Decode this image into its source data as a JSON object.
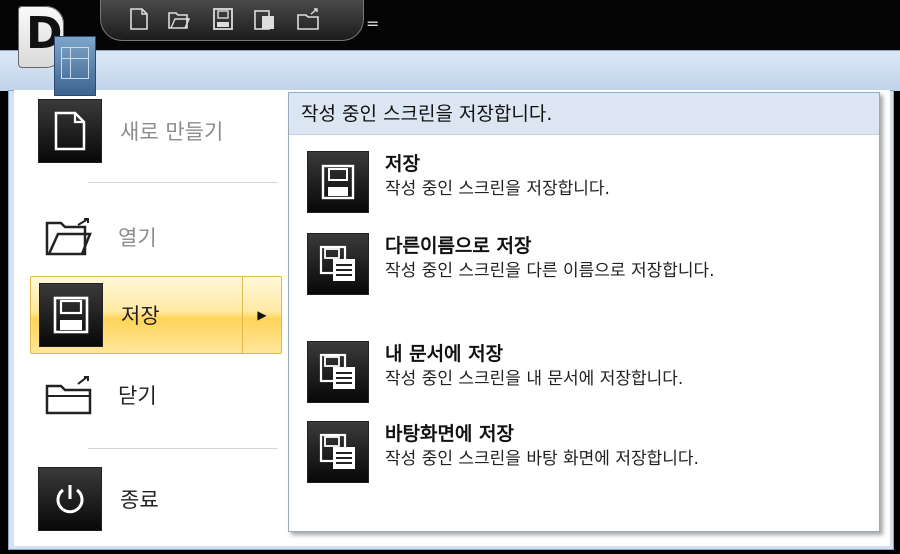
{
  "quick_access": {
    "buttons": [
      "new-icon",
      "open-icon",
      "save-icon",
      "paste-icon",
      "close-icon"
    ],
    "dropdown_glyph": "="
  },
  "left_menu": {
    "items": [
      {
        "label": "새로 만들기",
        "icon": "new-document-icon",
        "enabled": false
      },
      {
        "label": "열기",
        "icon": "open-folder-icon",
        "enabled": false
      },
      {
        "label": "저장",
        "icon": "save-icon",
        "enabled": true,
        "selected": true
      },
      {
        "label": "닫기",
        "icon": "close-folder-icon",
        "enabled": true
      },
      {
        "label": "종료",
        "icon": "power-icon",
        "enabled": true
      }
    ],
    "submenu_arrow": "▶"
  },
  "submenu": {
    "header": "작성 중인 스크린을 저장합니다.",
    "items": [
      {
        "title": "저장",
        "desc": "작성 중인 스크린을 저장합니다.",
        "icon": "save-icon"
      },
      {
        "title": "다른이름으로 저장",
        "desc": "작성 중인 스크린을 다른 이름으로 저장합니다.",
        "icon": "save-as-icon"
      },
      {
        "title": "내 문서에 저장",
        "desc": "작성 중인 스크린을 내 문서에 저장합니다.",
        "icon": "save-as-icon"
      },
      {
        "title": "바탕화면에 저장",
        "desc": "작성 중인 스크린을 바탕 화면에 저장합니다.",
        "icon": "save-as-icon"
      }
    ]
  },
  "colors": {
    "highlight": "#ffd45a",
    "panel_header": "#dce6f2",
    "frame": "#bfd3ea"
  }
}
